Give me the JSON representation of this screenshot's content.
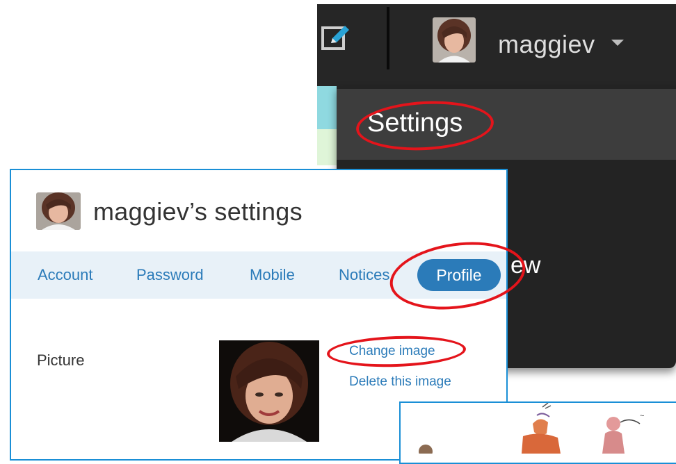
{
  "header": {
    "username": "maggiev",
    "compose_icon": "compose-tweet-icon",
    "caret_icon": "chevron-down-icon"
  },
  "dropdown": {
    "settings_label": "Settings",
    "partial_item": "ew"
  },
  "settings_page": {
    "title": "maggiev’s settings",
    "tabs": [
      {
        "label": "Account"
      },
      {
        "label": "Password"
      },
      {
        "label": "Mobile"
      },
      {
        "label": "Notices"
      },
      {
        "label": "Profile",
        "selected": true
      }
    ],
    "picture_label": "Picture",
    "change_image": "Change image",
    "delete_image": "Delete this image"
  },
  "colors": {
    "accent": "#2b7bb9",
    "topbar": "#262626",
    "annotation": "#e4141b",
    "panel_border": "#1a8fd6"
  }
}
